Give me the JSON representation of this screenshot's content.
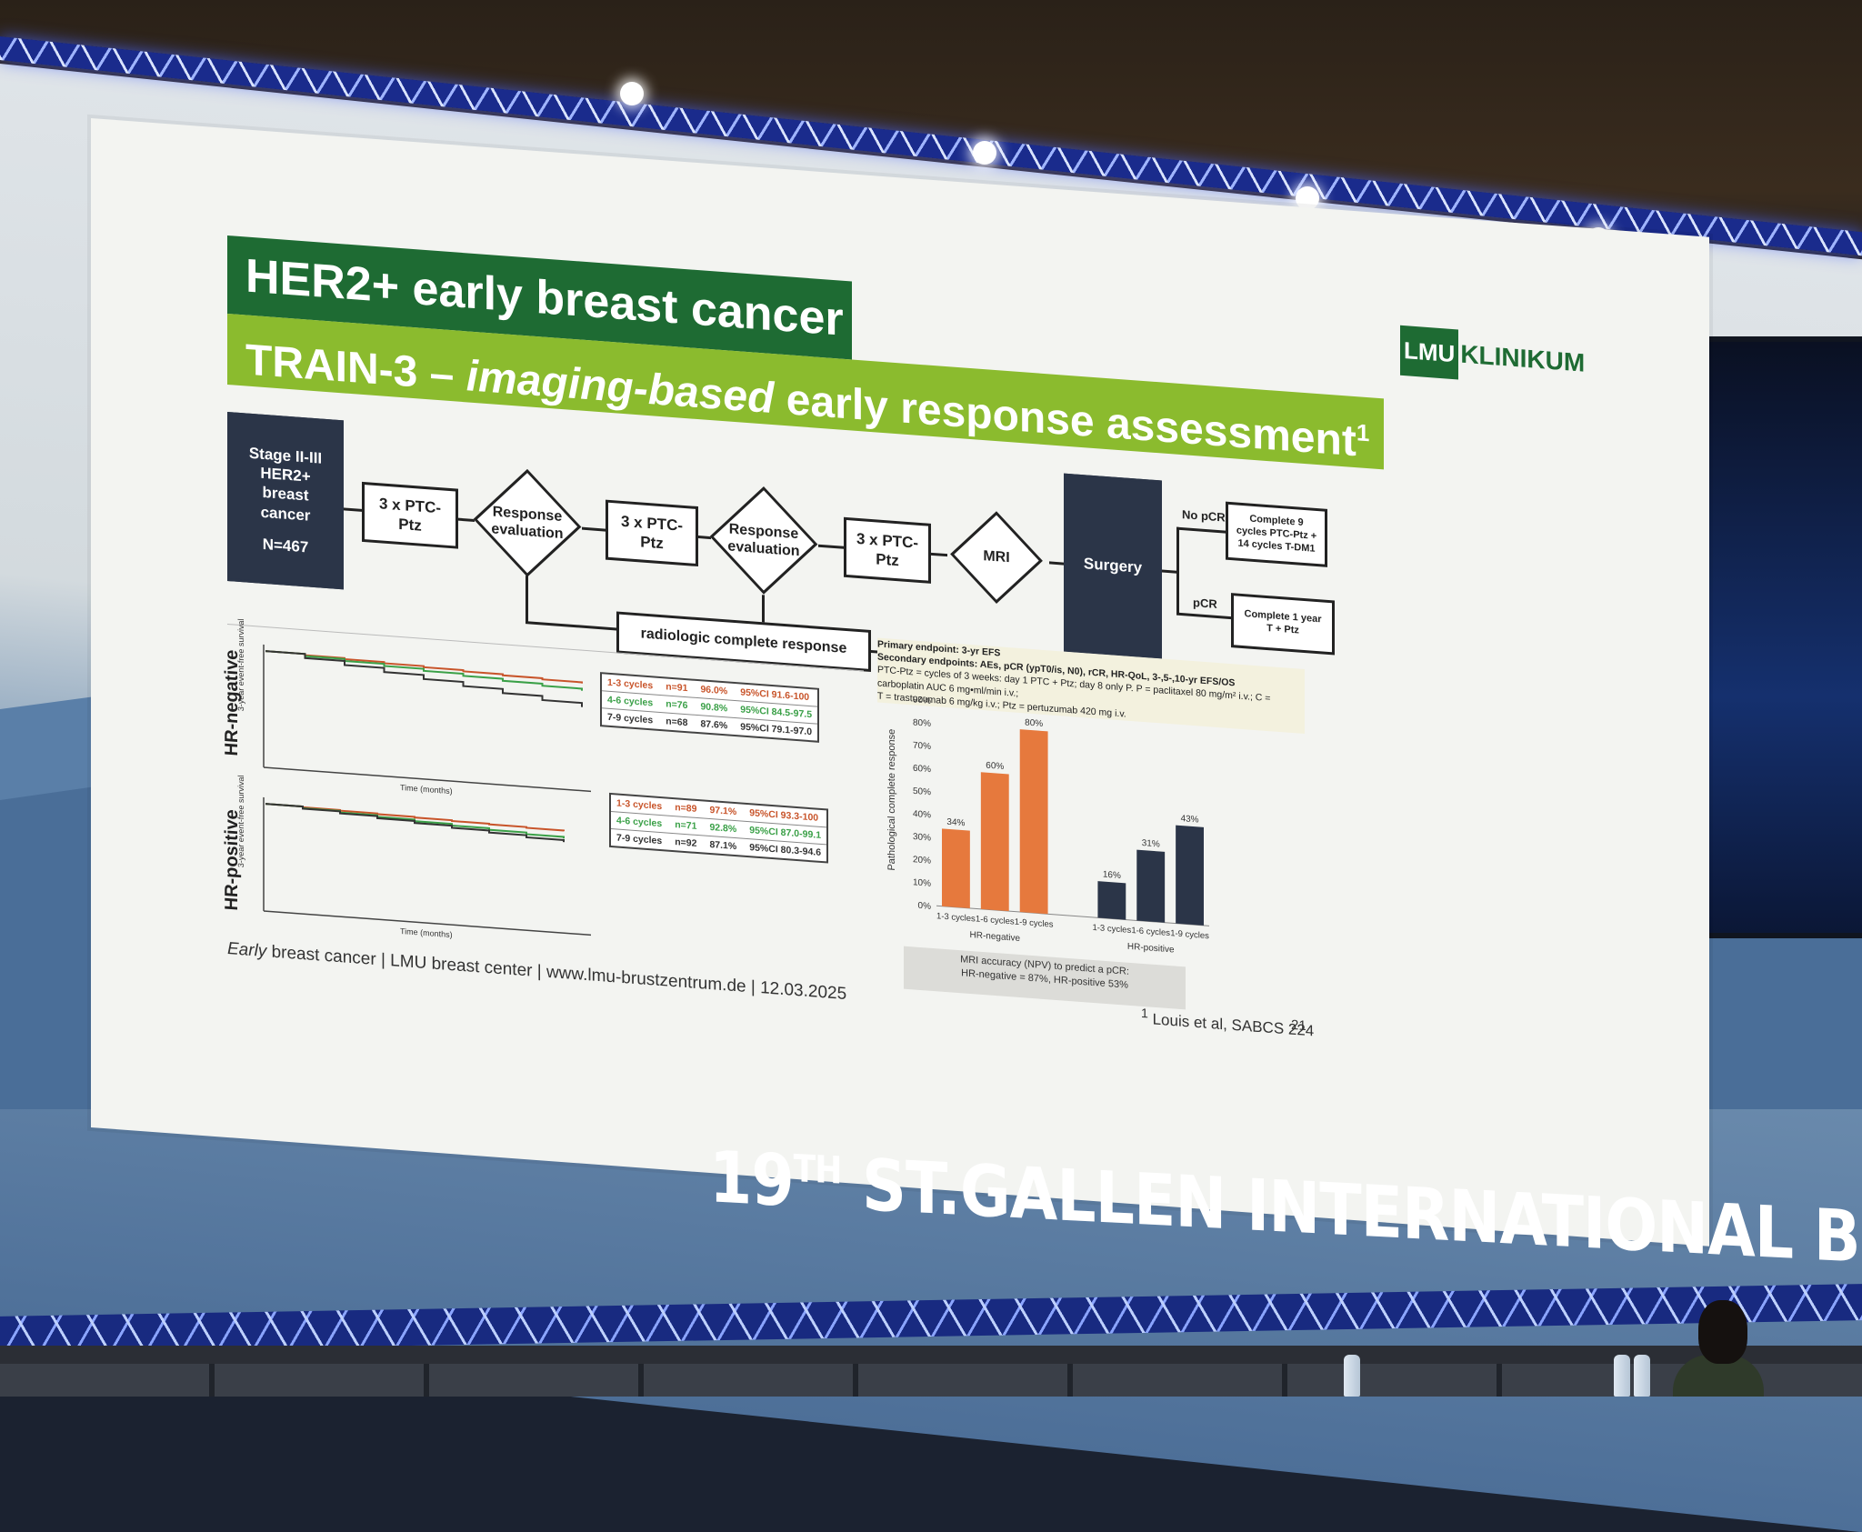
{
  "slide": {
    "title_line1": "HER2+ early breast cancer",
    "title_line2_prefix": "TRAIN-3 – ",
    "title_line2_italic": "imaging-based",
    "title_line2_suffix": " early response assessment",
    "title_sup": "1",
    "logo_box": "LMU",
    "logo_text": "KLINIKUM",
    "colors": {
      "dark_green": "#1e6b33",
      "lime_green": "#8bbb2e",
      "orange": "#e6793d",
      "navy": "#2b3548"
    }
  },
  "flowchart": {
    "start": [
      "Stage II-III",
      "HER2+",
      "breast",
      "cancer",
      "",
      "N=467"
    ],
    "step1": [
      "3 x PTC-",
      "Ptz"
    ],
    "eval1": [
      "Response",
      "evaluation"
    ],
    "step2": [
      "3 x PTC-",
      "Ptz"
    ],
    "eval2": [
      "Response",
      "evaluation"
    ],
    "step3": [
      "3 x PTC-",
      "Ptz"
    ],
    "mri": "MRI",
    "surgery": "Surgery",
    "no_pcr_label": "No pCR",
    "no_pcr_box": [
      "Complete 9",
      "cycles PTC-Ptz +",
      "14 cycles T-DM1"
    ],
    "pcr_label": "pCR",
    "pcr_box": [
      "Complete 1 year",
      "T + Ptz"
    ],
    "radiologic": "radiologic complete response"
  },
  "endpoints": {
    "primary": "Primary endpoint: 3-yr EFS",
    "secondary": "Secondary endpoints: AEs, pCR (ypT0/is, N0), rCR, HR-QoL, 3-,5-,10-yr EFS/OS",
    "ptc": "PTC-Ptz = cycles of 3 weeks: day 1 PTC + Ptz; day 8 only P. P = paclitaxel 80 mg/m² i.v.; C = carboplatin AUC 6 mg•ml/min i.v.;",
    "t": "T = trastuzumab 6 mg/kg i.v.; Ptz = pertuzumab 420 mg i.v."
  },
  "km_negative": {
    "label": "HR-negative",
    "y_axis": "3-year event-free survival",
    "x_axis": "Time (months)",
    "legend": [
      {
        "cycles": "1-3 cycles",
        "n": "n=91",
        "pct": "96.0%",
        "ci": "95%CI 91.6-100",
        "color": "#c8542a"
      },
      {
        "cycles": "4-6 cycles",
        "n": "n=76",
        "pct": "90.8%",
        "ci": "95%CI 84.5-97.5",
        "color": "#3aa047"
      },
      {
        "cycles": "7-9 cycles",
        "n": "n=68",
        "pct": "87.6%",
        "ci": "95%CI 79.1-97.0",
        "color": "#333333"
      }
    ]
  },
  "km_positive": {
    "label": "HR-positive",
    "y_axis": "3-year event-free survival",
    "x_axis": "Time (months)",
    "legend": [
      {
        "cycles": "1-3 cycles",
        "n": "n=89",
        "pct": "97.1%",
        "ci": "95%CI 93.3-100",
        "color": "#c8542a"
      },
      {
        "cycles": "4-6 cycles",
        "n": "n=71",
        "pct": "92.8%",
        "ci": "95%CI 87.0-99.1",
        "color": "#3aa047"
      },
      {
        "cycles": "7-9 cycles",
        "n": "n=92",
        "pct": "87.1%",
        "ci": "95%CI 80.3-94.6",
        "color": "#333333"
      }
    ]
  },
  "chart_data": {
    "type": "bar",
    "ylabel": "Pathological complete response",
    "ylim": [
      0,
      90
    ],
    "y_ticks": [
      "0%",
      "10%",
      "20%",
      "30%",
      "40%",
      "50%",
      "60%",
      "70%",
      "80%",
      "90%"
    ],
    "categories": [
      "1-3 cycles",
      "1-6 cycles",
      "1-9 cycles",
      "1-3 cycles",
      "1-6 cycles",
      "1-9 cycles"
    ],
    "groups": [
      "HR-negative",
      "HR-positive"
    ],
    "values": [
      34,
      60,
      80,
      16,
      31,
      43
    ],
    "value_labels": [
      "34%",
      "60%",
      "80%",
      "16%",
      "31%",
      "43%"
    ],
    "colors": [
      "#e6793d",
      "#e6793d",
      "#e6793d",
      "#2b3548",
      "#2b3548",
      "#2b3548"
    ],
    "note_line1": "MRI accuracy (NPV) to predict a pCR:",
    "note_line2": "HR-negative = 87%, HR-positive 53%"
  },
  "footer": {
    "italic": "Early",
    "rest": " breast cancer | LMU breast center | www.lmu-brustzentrum.de | 12.03.2025",
    "ref_sup": "1",
    "ref": " Louis et al, SABCS 224",
    "page": "21"
  },
  "banner": {
    "num": "19",
    "sup": "TH",
    "text": " ST.GALLEN INTERNATIONAL BREAST CANCER CONFERENCE"
  }
}
